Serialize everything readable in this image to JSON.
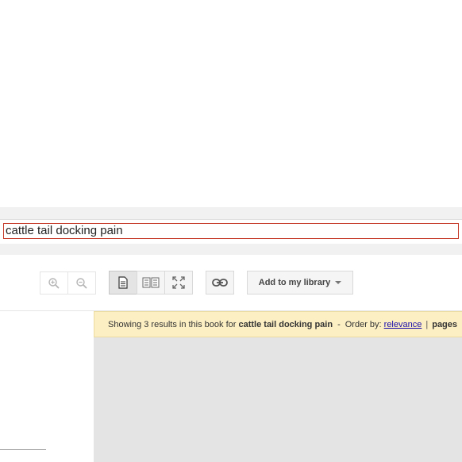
{
  "search": {
    "query": "cattle tail docking pain"
  },
  "toolbar": {
    "zoom_in_icon": "zoom-in-icon",
    "zoom_out_icon": "zoom-out-icon",
    "single_page_icon": "single-page-icon",
    "two_page_icon": "two-page-icon",
    "fullscreen_icon": "fullscreen-icon",
    "link_icon": "link-icon",
    "add_to_library_label": "Add to my library"
  },
  "results": {
    "prefix": "Showing 3 results in this book for",
    "query": "cattle tail docking pain",
    "dash": "-",
    "order_by_label": "Order by:",
    "relevance_label": "relevance",
    "separator": "|",
    "pages_label": "pages"
  },
  "colors": {
    "search_border": "#c53929",
    "results_bg": "#fcefc4",
    "viewer_bg": "#e4e4e4",
    "link": "#1a0dab"
  }
}
